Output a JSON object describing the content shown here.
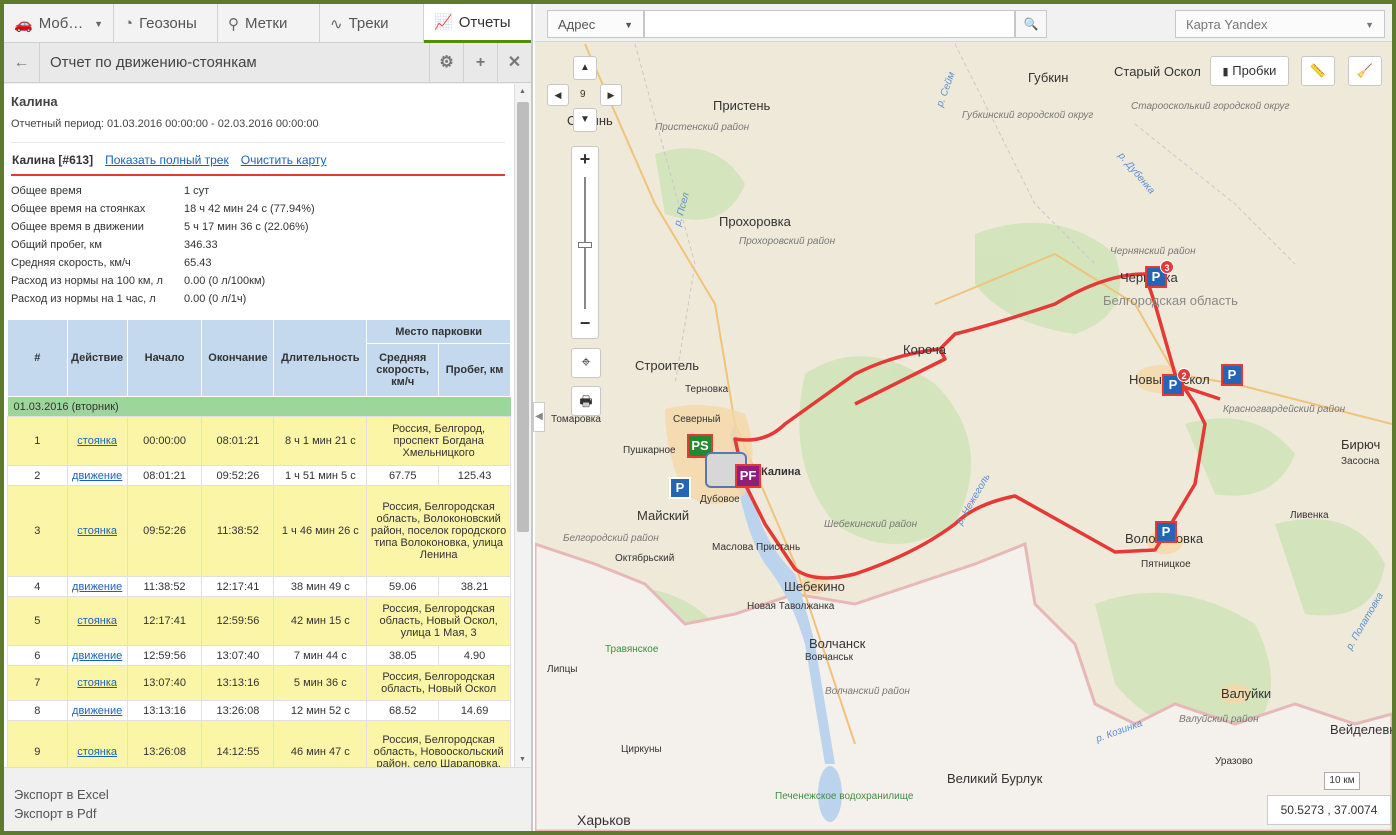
{
  "tabs": [
    {
      "label": "Моб…",
      "icon": "car-icon"
    },
    {
      "label": "Геозоны",
      "icon": "geofence-icon"
    },
    {
      "label": "Метки",
      "icon": "pin-icon"
    },
    {
      "label": "Треки",
      "icon": "track-icon"
    },
    {
      "label": "Отчеты",
      "icon": "chart-icon",
      "active": true
    }
  ],
  "panel": {
    "title": "Отчет по движению-стоянкам",
    "object_name": "Калина",
    "period": "Отчетный период: 01.03.2016 00:00:00 - 02.03.2016 00:00:00",
    "card_name": "Калина [#613]",
    "show_track": "Показать полный трек",
    "clear_map": "Очистить карту"
  },
  "stats": [
    {
      "k": "Общее время",
      "v": "1 сут"
    },
    {
      "k": "Общее время на стоянках",
      "v": "18 ч 42 мин 24 с (77.94%)"
    },
    {
      "k": "Общее время в движении",
      "v": "5 ч 17 мин 36 с (22.06%)"
    },
    {
      "k": "Общий пробег, км",
      "v": "346.33"
    },
    {
      "k": "Средняя скорость, км/ч",
      "v": "65.43"
    },
    {
      "k": "Расход из нормы на 100 км, л",
      "v": "0.00 (0 л/100км)"
    },
    {
      "k": "Расход из нормы на 1 час, л",
      "v": "0.00 (0 л/1ч)"
    }
  ],
  "table": {
    "headers": {
      "num": "#",
      "action": "Действие",
      "start": "Начало",
      "end": "Окончание",
      "duration": "Длительность",
      "place": "Место парковки",
      "speed": "Средняя скорость, км/ч",
      "mileage": "Пробег, км"
    },
    "day": "01.03.2016 (вторник)",
    "rows": [
      {
        "n": "1",
        "action": "стоянка",
        "start": "00:00:00",
        "end": "08:01:21",
        "dur": "8 ч 1 мин 21 с",
        "place": "Россия, Белгород, проспект Богдана Хмельницкого",
        "type": "stop"
      },
      {
        "n": "2",
        "action": "движение",
        "start": "08:01:21",
        "end": "09:52:26",
        "dur": "1 ч 51 мин 5 с",
        "speed": "67.75",
        "km": "125.43",
        "type": "move"
      },
      {
        "n": "3",
        "action": "стоянка",
        "start": "09:52:26",
        "end": "11:38:52",
        "dur": "1 ч 46 мин 26 с",
        "place": "Россия, Белгородская область, Волоконовский район, поселок городского типа Волоконовка, улица Ленина",
        "type": "stop"
      },
      {
        "n": "4",
        "action": "движение",
        "start": "11:38:52",
        "end": "12:17:41",
        "dur": "38 мин 49 с",
        "speed": "59.06",
        "km": "38.21",
        "type": "move"
      },
      {
        "n": "5",
        "action": "стоянка",
        "start": "12:17:41",
        "end": "12:59:56",
        "dur": "42 мин 15 с",
        "place": "Россия, Белгородская область, Новый Оскол, улица 1 Мая, 3",
        "type": "stop"
      },
      {
        "n": "6",
        "action": "движение",
        "start": "12:59:56",
        "end": "13:07:40",
        "dur": "7 мин 44 с",
        "speed": "38.05",
        "km": "4.90",
        "type": "move"
      },
      {
        "n": "7",
        "action": "стоянка",
        "start": "13:07:40",
        "end": "13:13:16",
        "dur": "5 мин 36 с",
        "place": "Россия, Белгородская область, Новый Оскол",
        "type": "stop"
      },
      {
        "n": "8",
        "action": "движение",
        "start": "13:13:16",
        "end": "13:26:08",
        "dur": "12 мин 52 с",
        "speed": "68.52",
        "km": "14.69",
        "type": "move"
      },
      {
        "n": "9",
        "action": "стоянка",
        "start": "13:26:08",
        "end": "14:12:55",
        "dur": "46 мин 47 с",
        "place": "Россия, Белгородская область, Новооскольский район, село Шараповка,",
        "type": "stop"
      }
    ]
  },
  "footer": {
    "excel": "Экспорт в Excel",
    "pdf": "Экспорт в Pdf"
  },
  "map": {
    "address_label": "Адрес",
    "search_placeholder": "",
    "map_type": "Карта Yandex",
    "traffic": "Пробки",
    "zoom_level": "9",
    "scale": "10 км",
    "coords": "50.5273 , 37.0074",
    "vehicle_label": "Калина",
    "markers": {
      "start": "PS",
      "finish": "PF",
      "park": "P"
    },
    "badges": [
      "3",
      "2"
    ],
    "places": [
      "Губкин",
      "Старый Оскол",
      "Пристень",
      "Обоянь",
      "Прохоровка",
      "Чернянка",
      "Белгородская область",
      "Короча",
      "Строитель",
      "Терновка",
      "Северный",
      "Пушкарное",
      "Новый Оскол",
      "Майский",
      "Дубовое",
      "Бирюч",
      "Засосна",
      "Волоконовка",
      "Пятницкое",
      "Ливенка",
      "Шебекино",
      "Новая Таволжанка",
      "Маслова Пристань",
      "Октябрьский",
      "Волчанск",
      "Вовчанськ",
      "Валуйки",
      "Вейделевка",
      "Уразово",
      "Великий Бурлук",
      "Харьков",
      "Томаровка",
      "Циркуны",
      "Белгородский район",
      "Шебекинский район",
      "Волчанский район",
      "Губкинский городской округ",
      "Староосколький городской округ",
      "Прохоровский район",
      "Пристенский район",
      "Чернянский район",
      "Красногвардейский район",
      "Валуйский район",
      "Травянское",
      "Липцы",
      "Печенежское водохранилище",
      "р. Нежеголь",
      "р. Дубенка",
      "р. Псел",
      "р. Козинка",
      "р. Полатовка",
      "р. Сейм"
    ]
  },
  "colors": {
    "accent": "#4d8e0f",
    "track": "#e53935",
    "parking": "#2565b5",
    "start": "#1f8a2e",
    "finish": "#8e1f7a",
    "stop_row": "#fbf5a8",
    "day_row": "#9dd69b",
    "header": "#c5d9ee"
  }
}
